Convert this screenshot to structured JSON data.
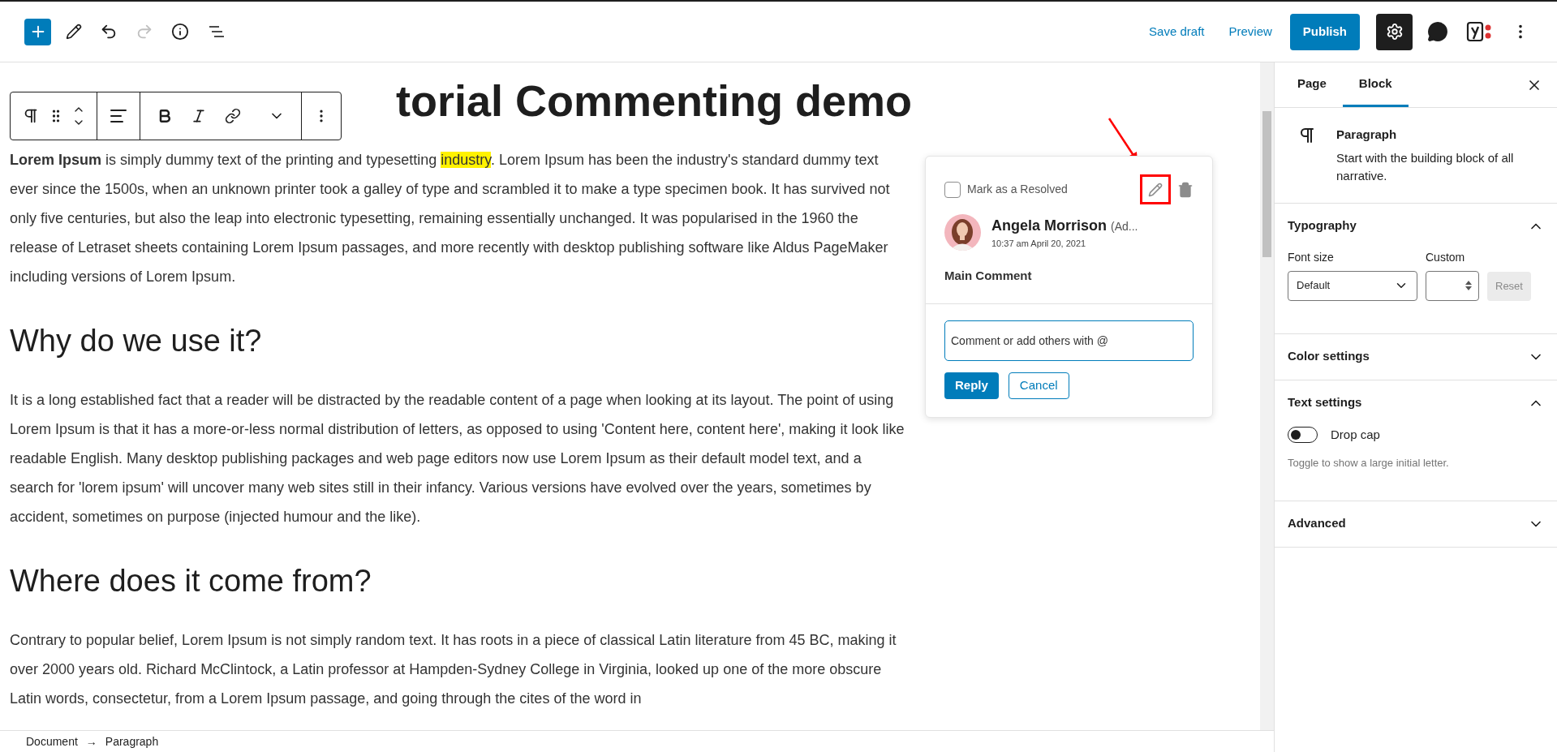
{
  "top_bar": {
    "tools": [
      {
        "kind": "add",
        "disabled": false
      },
      {
        "kind": "edit",
        "disabled": false
      },
      {
        "kind": "undo",
        "disabled": false
      },
      {
        "kind": "redo",
        "disabled": true
      },
      {
        "kind": "info",
        "disabled": false
      },
      {
        "kind": "list",
        "disabled": false
      }
    ],
    "save_draft": "Save draft",
    "preview": "Preview",
    "publish": "Publish",
    "settings": {
      "selected": true
    }
  },
  "title": "torial Commenting demo",
  "content": [
    {
      "kind": "paragraph",
      "before": "**Lorem Ipsum** is simply dummy text of the printing and typesetting ",
      "highlight": "industry",
      "after": ". Lorem Ipsum has been the industry's standard dummy text ever since the 1500s, when an unknown printer took a galley of type and scrambled it to make a type specimen book. It has survived not only five centuries, but also the leap into electronic typesetting, remaining essentially unchanged. It was popularised in the 1960 the release of Letraset sheets containing Lorem Ipsum passages, and more recently with desktop publishing software like Aldus PageMaker including versions of Lorem Ipsum."
    },
    {
      "kind": "heading",
      "text": "Why do we use it?"
    },
    {
      "kind": "paragraph",
      "before": "It is a long established fact that a reader will be distracted by the readable content of a page when looking at its layout. The point of using Lorem Ipsum is that it has a more-or-less normal distribution of letters, as opposed to using 'Content here, content here', making it look like readable English. Many desktop publishing packages and web page editors now use Lorem Ipsum as their default model text, and a search for 'lorem ipsum' will uncover many web sites still in their infancy. Various versions have evolved over the years, sometimes by accident, sometimes on purpose (injected humour and the like)."
    },
    {
      "kind": "heading",
      "text": "Where does it come from?"
    },
    {
      "kind": "paragraph",
      "before": "Contrary to popular belief, Lorem Ipsum is not simply random text. It has roots in a piece of classical Latin literature from 45 BC, making it over 2000 years old. Richard McClintock, a Latin professor at Hampden-Sydney College in Virginia, looked up one of the more obscure Latin words, consectetur, from a Lorem Ipsum passage, and going through the cites of the word in"
    }
  ],
  "comment": {
    "resolve_label": "Mark as a Resolved",
    "checked": false,
    "author": "Angela Morrison",
    "role": "(Ad...",
    "time": "10:37 am April 20, 2021",
    "text": "Main Comment",
    "placeholder": "Comment or add others with @",
    "reply": "Reply",
    "cancel": "Cancel"
  },
  "sidebar": {
    "tabs": [
      {
        "label": "Page",
        "selected": false
      },
      {
        "label": "Block",
        "selected": true
      }
    ],
    "block": {
      "name": "Paragraph",
      "description": "Start with the building block of all narrative."
    },
    "panels": [
      {
        "kind": "typography",
        "title": "Typography",
        "expanded": true,
        "font_size_label": "Font size",
        "select_value": "Default",
        "custom_label": "Custom",
        "reset": "Reset",
        "reset_disabled": true
      },
      {
        "title": "Color settings",
        "expanded": false
      },
      {
        "kind": "text",
        "title": "Text settings",
        "expanded": true,
        "toggle_label": "Drop cap",
        "on": false,
        "help": "Toggle to show a large initial letter."
      },
      {
        "title": "Advanced",
        "expanded": false
      }
    ]
  },
  "breadcrumb": {
    "items": [
      "Document",
      "Paragraph"
    ],
    "separator": "→"
  }
}
